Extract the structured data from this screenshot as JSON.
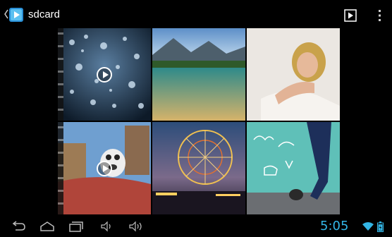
{
  "actionbar": {
    "title": "sdcard",
    "icons": {
      "back": "chevron-left-icon",
      "app": "gallery-icon",
      "slideshow": "slideshow-icon",
      "overflow": "overflow-menu-icon"
    },
    "accent_color": "#2a8fd6"
  },
  "gallery": {
    "items": [
      {
        "name": "water-droplets-video",
        "type": "video"
      },
      {
        "name": "mountain-lake-photo",
        "type": "photo"
      },
      {
        "name": "woman-portrait-photo",
        "type": "photo"
      },
      {
        "name": "cartoon-bear-video",
        "type": "video"
      },
      {
        "name": "ferris-wheel-photo",
        "type": "photo"
      },
      {
        "name": "doodle-wall-photo",
        "type": "photo"
      }
    ]
  },
  "navbar": {
    "buttons": [
      "back-icon",
      "home-icon",
      "recent-apps-icon",
      "volume-down-icon",
      "volume-up-icon"
    ],
    "clock": "5:05",
    "clock_color": "#33b5e5",
    "status_icons": [
      "wifi-icon",
      "battery-icon"
    ]
  }
}
